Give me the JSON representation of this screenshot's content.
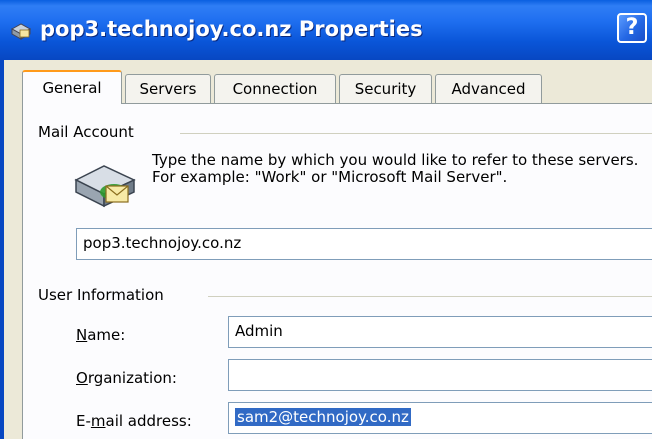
{
  "window": {
    "title": "pop3.technojoy.co.nz Properties",
    "help_label": "?"
  },
  "tabs": [
    {
      "label": "General",
      "active": true
    },
    {
      "label": "Servers",
      "active": false
    },
    {
      "label": "Connection",
      "active": false
    },
    {
      "label": "Security",
      "active": false
    },
    {
      "label": "Advanced",
      "active": false
    }
  ],
  "mail_account": {
    "group_label": "Mail Account",
    "description": "Type the name by which you would like to refer to these servers.  For example: \"Work\" or \"Microsoft Mail Server\".",
    "account_name": "pop3.technojoy.co.nz"
  },
  "user_info": {
    "group_label": "User Information",
    "name_label_key": "N",
    "name_label_rest": "ame:",
    "name_value": "Admin",
    "org_label_key": "O",
    "org_label_rest": "rganization:",
    "org_value": "",
    "email_label_pre": "E-",
    "email_label_key": "m",
    "email_label_rest": "ail address:",
    "email_value": "sam2@technojoy.co.nz"
  },
  "colors": {
    "titlebar": "#0a55d8",
    "tab_highlight": "#ff9a1a",
    "selection": "#316ac5"
  }
}
